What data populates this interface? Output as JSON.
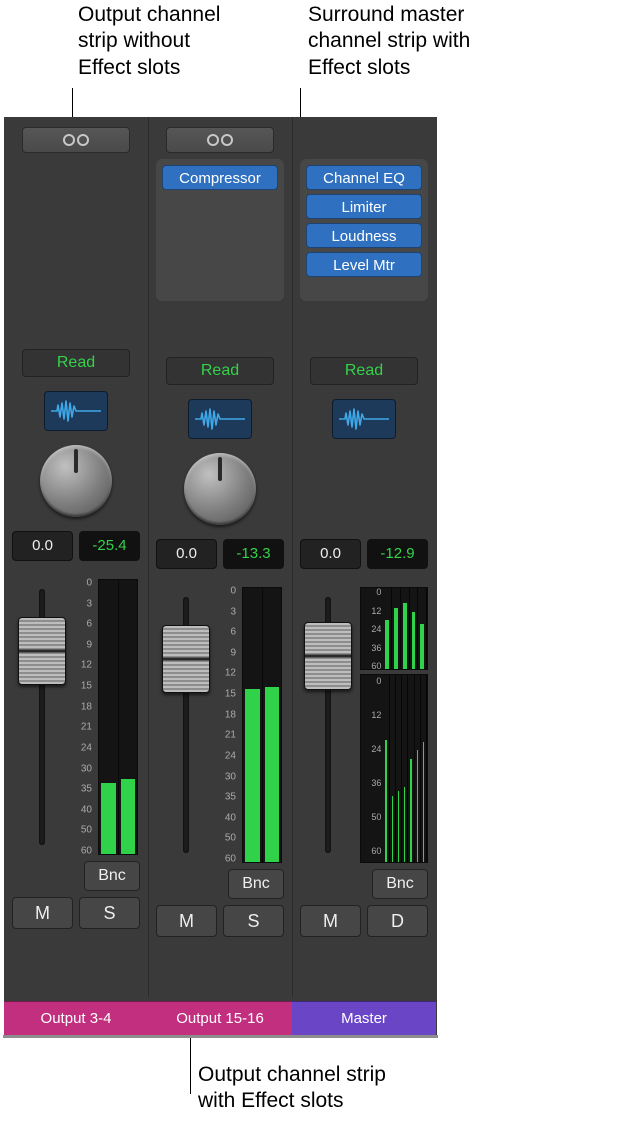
{
  "callouts": {
    "top_left": "Output channel\nstrip without\nEffect slots",
    "top_right": "Surround master\nchannel strip with\nEffect slots",
    "bottom": "Output channel strip\nwith Effect slots"
  },
  "strips": [
    {
      "has_io_button": true,
      "fx_slots": [],
      "automation": "Read",
      "gain_db": "0.0",
      "level_db": "-25.4",
      "fader_pos_pct": 26,
      "meter_type": "stereo",
      "meter_fill_pct": [
        26.0,
        27.5
      ],
      "scale_ticks": [
        "0",
        "3",
        "6",
        "9",
        "12",
        "15",
        "18",
        "21",
        "24",
        "30",
        "35",
        "40",
        "50",
        "60"
      ],
      "bnc_label": "Bnc",
      "mute_label": "M",
      "solo_label": "S",
      "name": "Output 3-4",
      "name_color": "output"
    },
    {
      "has_io_button": true,
      "fx_slots": [
        "Compressor"
      ],
      "automation": "Read",
      "gain_db": "0.0",
      "level_db": "-13.3",
      "fader_pos_pct": 26,
      "meter_type": "stereo",
      "meter_fill_pct": [
        63.0,
        64.0
      ],
      "scale_ticks": [
        "0",
        "3",
        "6",
        "9",
        "12",
        "15",
        "18",
        "21",
        "24",
        "30",
        "35",
        "40",
        "50",
        "60"
      ],
      "bnc_label": "Bnc",
      "mute_label": "M",
      "solo_label": "S",
      "name": "Output 15-16",
      "name_color": "output"
    },
    {
      "has_io_button": false,
      "fx_slots": [
        "Channel EQ",
        "Limiter",
        "Loudness",
        "Level Mtr"
      ],
      "automation": "Read",
      "gain_db": "0.0",
      "level_db": "-12.9",
      "fader_pos_pct": 25,
      "meter_type": "surround",
      "surround_top_pct": [
        60,
        75,
        82,
        70,
        55
      ],
      "surround_bottom_pct": [
        65,
        35,
        38,
        40,
        55,
        60,
        64
      ],
      "surround_top_scale": [
        "0",
        "12",
        "24",
        "36",
        "60"
      ],
      "surround_bottom_scale": [
        "0",
        "12",
        "24",
        "36",
        "50",
        "60"
      ],
      "bnc_label": "Bnc",
      "mute_label": "M",
      "solo_label": "D",
      "name": "Master",
      "name_color": "master"
    }
  ]
}
